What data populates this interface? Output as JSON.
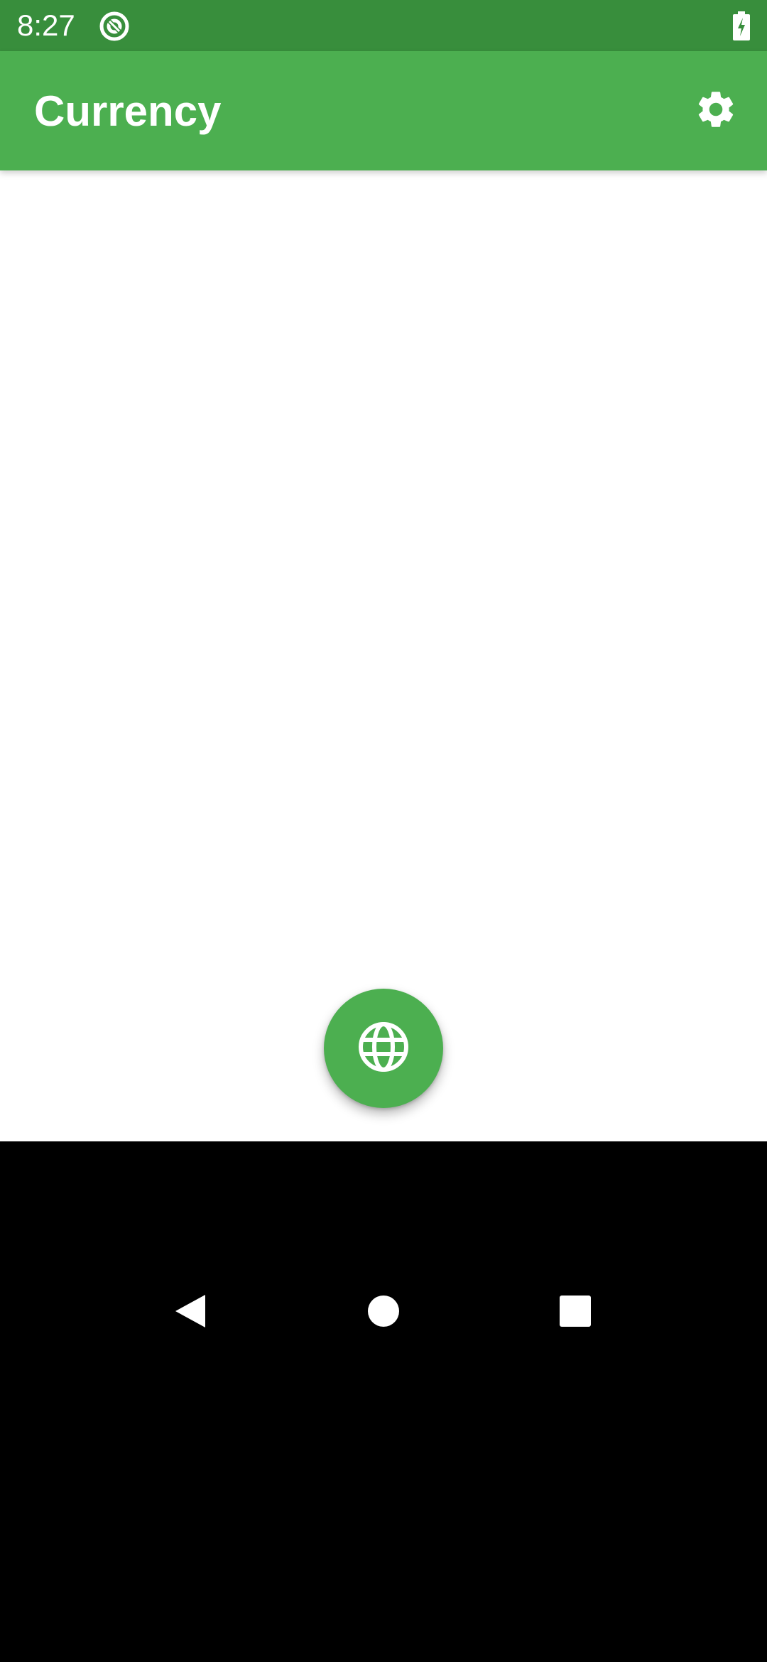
{
  "status_bar": {
    "time": "8:27",
    "background_color": "#388E3C",
    "app_icon": "sync-circle-icon",
    "battery_icon": "battery-charging-icon"
  },
  "app_bar": {
    "title": "Currency",
    "background_color": "#4CAF50",
    "settings_icon": "gear-icon"
  },
  "content": {
    "background_color": "#FFFFFF"
  },
  "fab": {
    "icon": "globe-icon",
    "background_color": "#4CAF50"
  },
  "nav_bar": {
    "back_icon": "back-triangle-icon",
    "home_icon": "home-circle-icon",
    "recents_icon": "recents-square-icon",
    "background_color": "#000000"
  }
}
